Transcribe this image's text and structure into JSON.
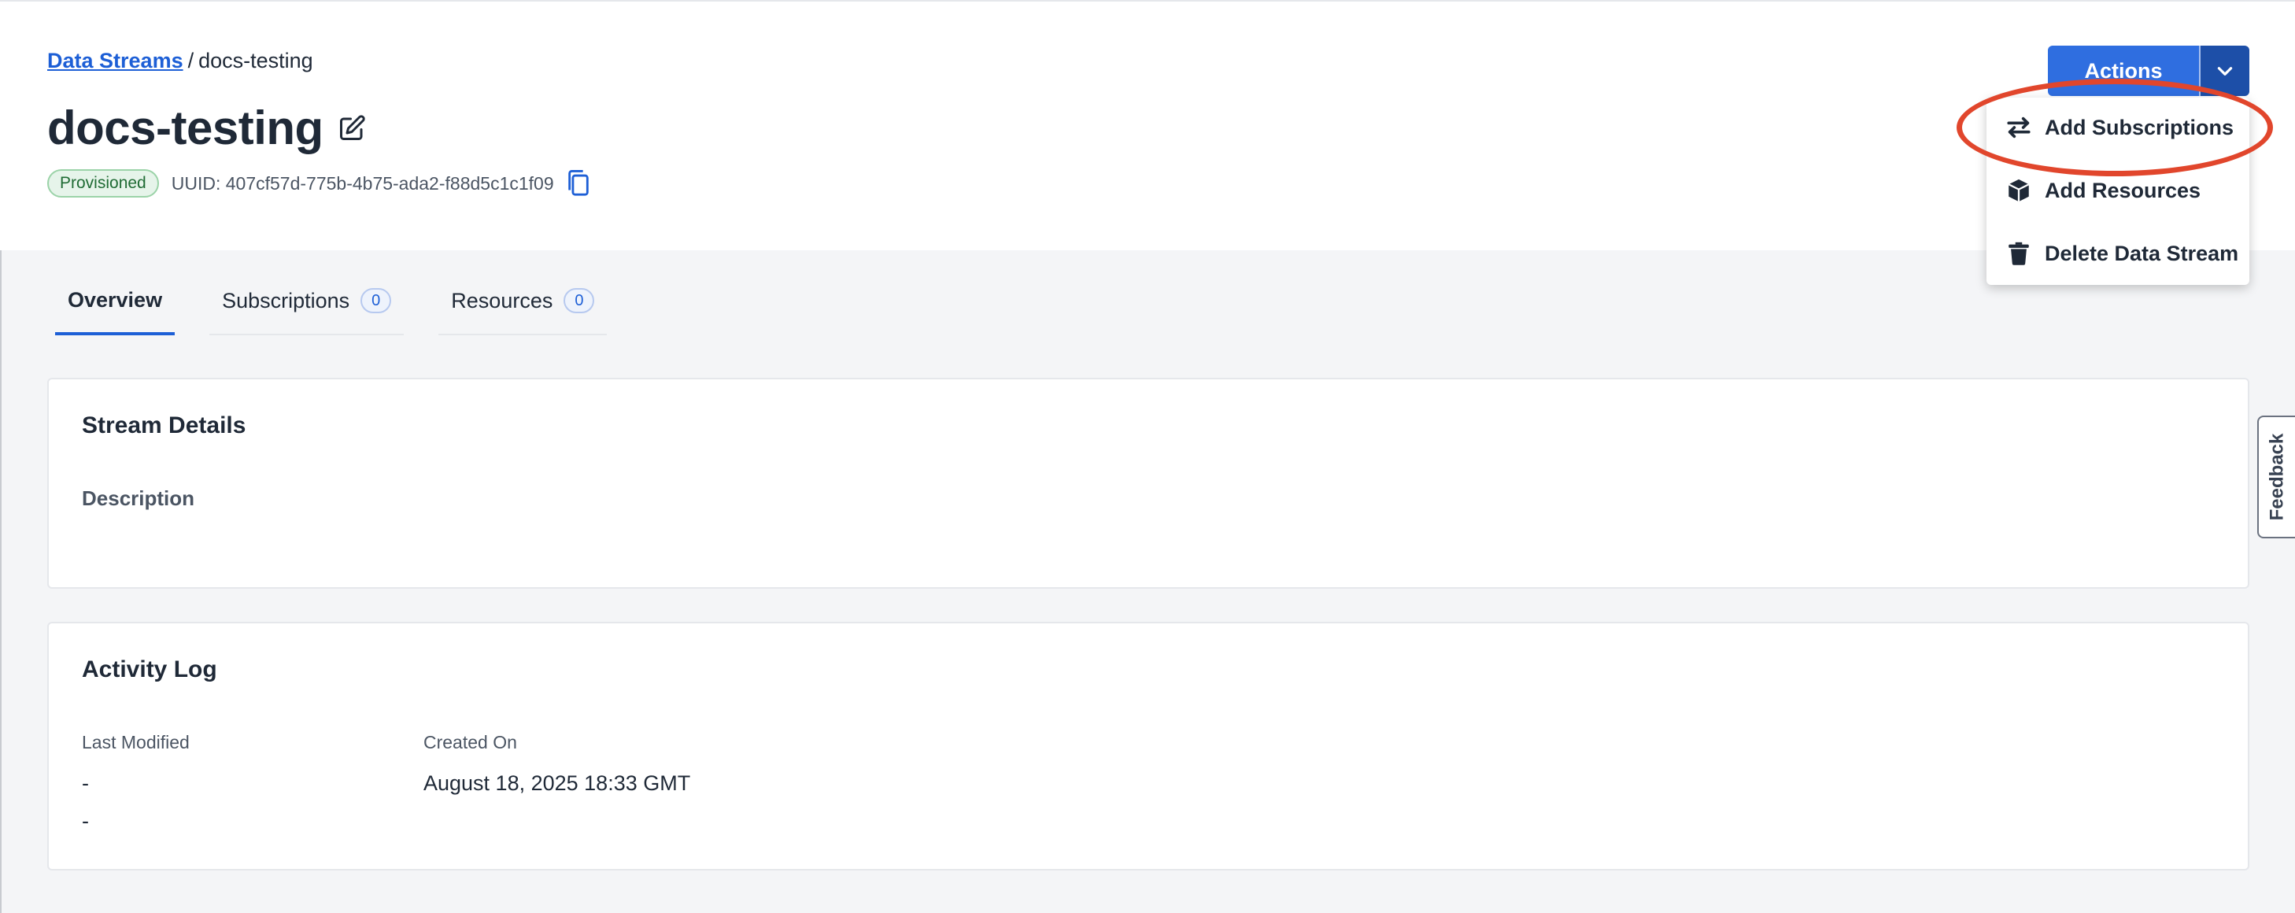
{
  "breadcrumb": {
    "parent": "Data Streams",
    "separator": "/",
    "current": "docs-testing"
  },
  "page": {
    "title": "docs-testing",
    "status_badge": "Provisioned",
    "uuid": "UUID: 407cf57d-775b-4b75-ada2-f88d5c1c1f09"
  },
  "actions": {
    "label": "Actions",
    "menu": [
      {
        "label": "Add Subscriptions",
        "icon": "swap-arrows-icon"
      },
      {
        "label": "Add Resources",
        "icon": "cube-icon"
      },
      {
        "label": "Delete Data Stream",
        "icon": "trash-icon"
      }
    ]
  },
  "tabs": [
    {
      "label": "Overview",
      "active": true
    },
    {
      "label": "Subscriptions",
      "count": "0"
    },
    {
      "label": "Resources",
      "count": "0"
    }
  ],
  "stream_details": {
    "title": "Stream Details",
    "description_label": "Description"
  },
  "activity_log": {
    "title": "Activity Log",
    "last_modified_label": "Last Modified",
    "last_modified_value": "-",
    "last_modified_value2": "-",
    "created_on_label": "Created On",
    "created_on_value": "August 18, 2025 18:33 GMT"
  },
  "feedback": {
    "label": "Feedback"
  },
  "colors": {
    "primary": "#2f6ee0",
    "primary_dark": "#1d4fa8",
    "highlight": "#e1462c",
    "success": "#1f6b34"
  }
}
